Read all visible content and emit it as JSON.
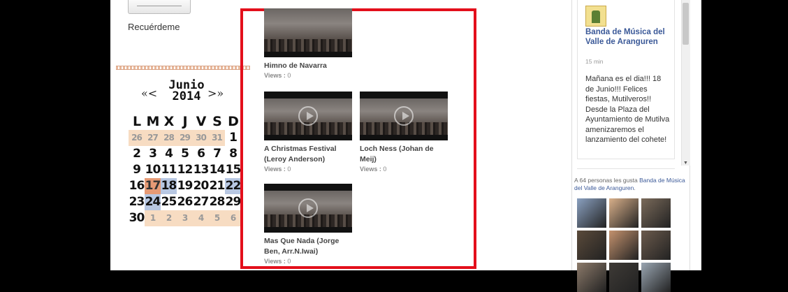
{
  "login": {
    "remember_label": "Recuérdeme"
  },
  "calendar": {
    "prev": "«<",
    "next": ">»",
    "month": "Junio",
    "year": "2014",
    "weekdays": [
      "L",
      "M",
      "X",
      "J",
      "V",
      "S",
      "D"
    ],
    "weeks": [
      [
        {
          "d": "26",
          "t": "other"
        },
        {
          "d": "27",
          "t": "other"
        },
        {
          "d": "28",
          "t": "other"
        },
        {
          "d": "29",
          "t": "other"
        },
        {
          "d": "30",
          "t": "other"
        },
        {
          "d": "31",
          "t": "other"
        },
        {
          "d": "1",
          "t": ""
        }
      ],
      [
        {
          "d": "2",
          "t": ""
        },
        {
          "d": "3",
          "t": ""
        },
        {
          "d": "4",
          "t": ""
        },
        {
          "d": "5",
          "t": ""
        },
        {
          "d": "6",
          "t": ""
        },
        {
          "d": "7",
          "t": ""
        },
        {
          "d": "8",
          "t": ""
        }
      ],
      [
        {
          "d": "9",
          "t": ""
        },
        {
          "d": "10",
          "t": ""
        },
        {
          "d": "11",
          "t": ""
        },
        {
          "d": "12",
          "t": ""
        },
        {
          "d": "13",
          "t": ""
        },
        {
          "d": "14",
          "t": ""
        },
        {
          "d": "15",
          "t": ""
        }
      ],
      [
        {
          "d": "16",
          "t": ""
        },
        {
          "d": "17",
          "t": "hl-orange"
        },
        {
          "d": "18",
          "t": "hl-blue"
        },
        {
          "d": "19",
          "t": ""
        },
        {
          "d": "20",
          "t": ""
        },
        {
          "d": "21",
          "t": ""
        },
        {
          "d": "22",
          "t": "hl-blue"
        }
      ],
      [
        {
          "d": "23",
          "t": ""
        },
        {
          "d": "24",
          "t": "hl-blue"
        },
        {
          "d": "25",
          "t": ""
        },
        {
          "d": "26",
          "t": ""
        },
        {
          "d": "27",
          "t": ""
        },
        {
          "d": "28",
          "t": ""
        },
        {
          "d": "29",
          "t": ""
        }
      ],
      [
        {
          "d": "30",
          "t": ""
        },
        {
          "d": "1",
          "t": "other"
        },
        {
          "d": "2",
          "t": "other"
        },
        {
          "d": "3",
          "t": "other"
        },
        {
          "d": "4",
          "t": "other"
        },
        {
          "d": "5",
          "t": "other"
        },
        {
          "d": "6",
          "t": "other"
        }
      ]
    ]
  },
  "videos": {
    "views_label": "Views :",
    "items": [
      {
        "title": "Himno de Navarra",
        "views": "0"
      },
      {
        "title": "A Christmas Festival (Leroy Anderson)",
        "views": "0"
      },
      {
        "title": "Loch Ness (Johan de Meij)",
        "views": "0"
      },
      {
        "title": "Mas Que Nada (Jorge Ben, Arr.N.Iwai)",
        "views": "0"
      }
    ]
  },
  "facebook": {
    "page_name": "Banda de Música del Valle de Aranguren",
    "post_time": "15 min",
    "post_text": "Mañana es el dia!!! 18 de Junio!!! Felices fiestas, Mutilveros!! Desde la Plaza del Ayuntamiento de Mutilva amenizaremos el lanzamiento del cohete!",
    "likes_prefix": "A 64 personas les gusta",
    "likes_link": "Banda de Música del Valle de Aranguren",
    "likes_suffix": ".",
    "faces": [
      "#8aa0c0",
      "#d9b08a",
      "#7a6a5a",
      "#5a4a3a",
      "#c4926e",
      "#6b5a4c",
      "#8c7a6a",
      "#3e3a36",
      "#9aa6b2"
    ]
  },
  "colors": {
    "highlight_border": "#e30f1b",
    "fb_link": "#3b5998",
    "cal_other": "#f7dcc2",
    "cal_orange": "#e69a75",
    "cal_blue": "#b7c7e2"
  }
}
